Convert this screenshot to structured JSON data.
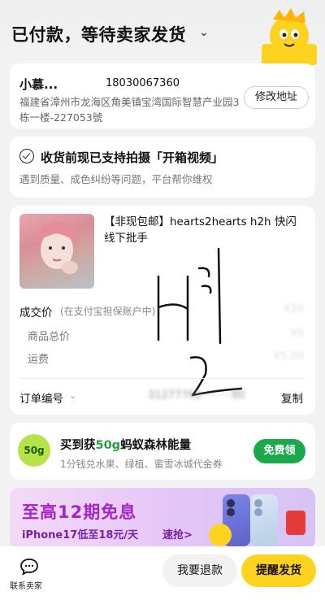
{
  "header": {
    "status_title": "已付款，等待卖家发货"
  },
  "address": {
    "name": "小慕...",
    "phone": "18030067360",
    "detail": "福建省漳州市龙海区角美镇宝湾国际智慧产业园3栋一楼-227053號",
    "edit_label": "修改地址"
  },
  "unboxing": {
    "title": "收货前现已支持拍摄「开箱视频」",
    "subtitle": "遇到质量、成色纠纷等问题，平台帮你维权"
  },
  "order": {
    "product_title": "【非现包邮】hearts2hearts h2h 快闪线下批手",
    "deal_price_label": "成交价",
    "deal_price_note": "(在支付宝担保账户中)",
    "goods_total_label": "商品总价",
    "shipping_label": "运费",
    "order_no_label": "订单编号",
    "copy_label": "复制",
    "blurred": {
      "deal_price": "¥20",
      "goods_total": "¥5",
      "shipping": "¥5.00",
      "order_no": "31277762·········80"
    }
  },
  "energy": {
    "badge": "50g",
    "title_prefix": "买到获",
    "title_amount": "50g",
    "title_suffix": "蚂蚁森林能量",
    "subtitle": "1分钱兑水果、绿植、蜜雪冰城代金券",
    "claim_label": "免费领"
  },
  "promo": {
    "title": "至高12期免息",
    "subtitle": "iPhone17低至18元/天",
    "cta": "速抢>"
  },
  "bottom_bar": {
    "contact_label": "联系卖家",
    "refund_label": "我要退款",
    "remind_label": "提醒发货"
  },
  "colors": {
    "accent_yellow": "#ffd21f",
    "green": "#1ba94c",
    "promo_purple": "#a326c7"
  }
}
